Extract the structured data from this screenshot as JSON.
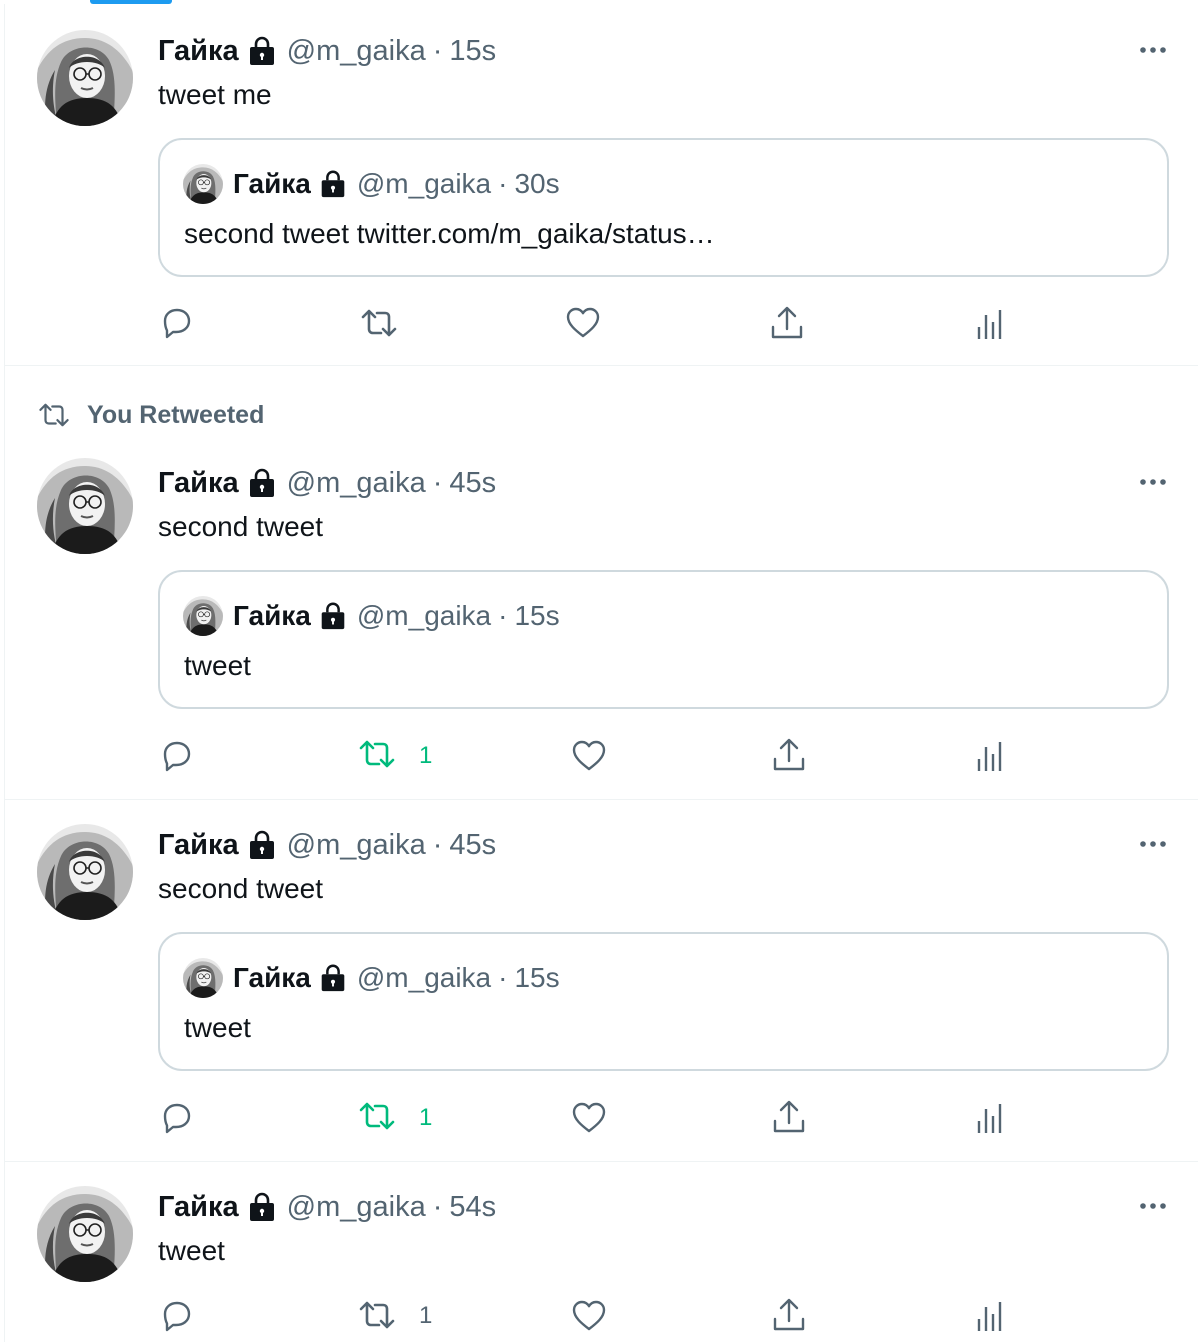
{
  "colors": {
    "accent": "#1d9bf0",
    "retweet_active": "#00ba7c",
    "secondary": "#536471"
  },
  "tweets": [
    {
      "author": {
        "name": "Гайка",
        "handle": "@m_gaika",
        "time": "15s",
        "locked_icon": "lock-icon"
      },
      "text": "tweet me",
      "quote": {
        "author": {
          "name": "Гайка",
          "handle": "@m_gaika",
          "time": "30s"
        },
        "text": "second tweet twitter.com/m_gaika/status…"
      },
      "actions": {
        "retweeted": false
      }
    },
    {
      "social_context": "You Retweeted",
      "author": {
        "name": "Гайка",
        "handle": "@m_gaika",
        "time": "45s",
        "locked_icon": "lock-icon"
      },
      "text": "second tweet",
      "quote": {
        "author": {
          "name": "Гайка",
          "handle": "@m_gaika",
          "time": "15s"
        },
        "text": "tweet"
      },
      "actions": {
        "retweeted": true,
        "retweet_count": "1"
      }
    },
    {
      "author": {
        "name": "Гайка",
        "handle": "@m_gaika",
        "time": "45s",
        "locked_icon": "lock-icon"
      },
      "text": "second tweet",
      "quote": {
        "author": {
          "name": "Гайка",
          "handle": "@m_gaika",
          "time": "15s"
        },
        "text": "tweet"
      },
      "actions": {
        "retweeted": true,
        "retweet_count": "1"
      }
    },
    {
      "author": {
        "name": "Гайка",
        "handle": "@m_gaika",
        "time": "54s",
        "locked_icon": "lock-icon"
      },
      "text": "tweet",
      "actions": {
        "retweeted": false,
        "retweet_count": "1"
      }
    }
  ],
  "separator": "·"
}
